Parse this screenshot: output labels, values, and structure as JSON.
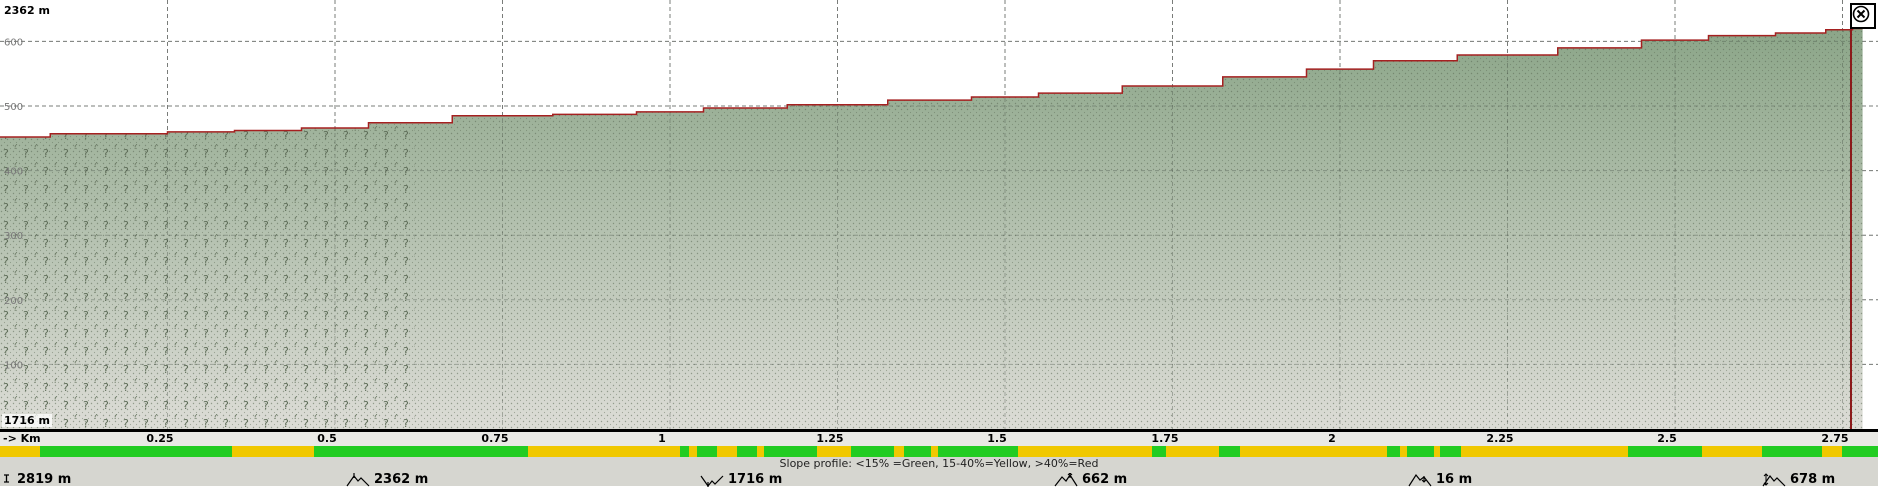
{
  "elevation_chart": {
    "max_label": "2362 m",
    "min_label": "1716 m",
    "y_tick_labels": [
      "600",
      "500",
      "400",
      "300",
      "200",
      "100"
    ],
    "distance_unit": "-> Km",
    "x_tick_labels": [
      "0.25",
      "0.5",
      "0.75",
      "1",
      "1.25",
      "1.5",
      "1.75",
      "2",
      "2.25",
      "2.5",
      "2.75"
    ]
  },
  "chart_data": {
    "type": "area",
    "xlabel": "Km",
    "ylabel": "",
    "xlim": [
      0,
      2.8
    ],
    "ylim": [
      0,
      650
    ],
    "x_ticks": [
      0.25,
      0.5,
      0.75,
      1,
      1.25,
      1.5,
      1.75,
      2,
      2.25,
      2.5,
      2.75
    ],
    "y_ticks": [
      100,
      200,
      300,
      400,
      500,
      600
    ],
    "x": [
      0,
      0.05,
      0.1,
      0.2,
      0.3,
      0.4,
      0.5,
      0.6,
      0.75,
      0.9,
      1.0,
      1.1,
      1.25,
      1.4,
      1.5,
      1.6,
      1.75,
      1.9,
      2.0,
      2.1,
      2.25,
      2.4,
      2.5,
      2.6,
      2.7,
      2.75,
      2.78
    ],
    "y": [
      452,
      452,
      457,
      457,
      460,
      462,
      466,
      474,
      485,
      487,
      491,
      497,
      502,
      509,
      514,
      520,
      531,
      545,
      557,
      570,
      579,
      590,
      602,
      609,
      613,
      618,
      620
    ],
    "colors": {
      "fill": "#8fa88e",
      "line": "#a52020"
    },
    "grid": true
  },
  "slope_profile": {
    "legend": "Slope profile: <15% =Green, 15-40%=Yellow, >40%=Red",
    "colors": {
      "green": "#22cc22",
      "yellow": "#f0c800",
      "red": "#ff0000"
    },
    "yellow_segments_km": [
      [
        0.0,
        0.06
      ],
      [
        0.347,
        0.468
      ],
      [
        0.788,
        1.015
      ],
      [
        1.028,
        1.04
      ],
      [
        1.07,
        1.1
      ],
      [
        1.13,
        1.14
      ],
      [
        1.22,
        1.27
      ],
      [
        1.335,
        1.35
      ],
      [
        1.39,
        1.4
      ],
      [
        1.52,
        1.72
      ],
      [
        1.74,
        1.82
      ],
      [
        1.85,
        2.07
      ],
      [
        2.09,
        2.1
      ],
      [
        2.14,
        2.15
      ],
      [
        2.18,
        2.43
      ],
      [
        2.54,
        2.63
      ],
      [
        2.72,
        2.75
      ]
    ]
  },
  "stats": {
    "total_distance": "2819 m",
    "max_elevation": "2362 m",
    "min_elevation": "1716 m",
    "ascent": "662 m",
    "descent": "16 m",
    "elevation_difference": "678 m"
  }
}
